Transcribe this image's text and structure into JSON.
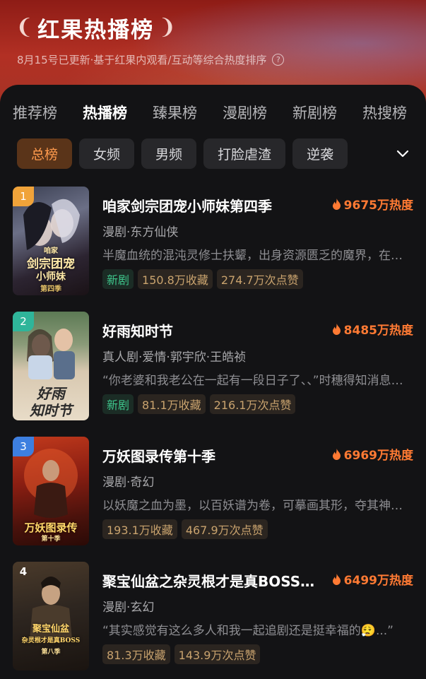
{
  "header": {
    "title": "红果热播榜",
    "subtitle": "8月15号已更新·基于红果内观看/互动等综合热度排序"
  },
  "tabs": [
    "推荐榜",
    "热播榜",
    "臻果榜",
    "漫剧榜",
    "新剧榜",
    "热搜榜"
  ],
  "active_tab": "热播榜",
  "filters": [
    "总榜",
    "女频",
    "男频",
    "打脸虐渣",
    "逆袭"
  ],
  "active_filter": "总榜",
  "colors": {
    "accent": "#ff7a33",
    "new_tag": "#3ec58b",
    "header_red": "#b23024"
  },
  "items": [
    {
      "rank": "1",
      "title": "咱家剑宗团宠小师妹第四季",
      "heat": "9675万热度",
      "meta": "漫剧·东方仙侠",
      "desc": "半魔血统的混沌灵修士扶颦，出身资源匮乏的魔界，在宗门中努力修炼成长",
      "tags": [
        "新剧",
        "150.8万收藏",
        "274.7万次点赞"
      ],
      "poster_text": [
        "咱家",
        "剑宗团宠",
        "小师妹",
        "第四季"
      ]
    },
    {
      "rank": "2",
      "title": "好雨知时节",
      "heat": "8485万热度",
      "meta": "真人剧·爱情·郭宇欣·王皓祯",
      "desc": "“你老婆和我老公在一起有一段日子了、、”时穗得知消息后陷入沉思",
      "tags": [
        "新剧",
        "81.1万收藏",
        "216.1万次点赞"
      ],
      "poster_text": [
        "好雨",
        "知时节"
      ]
    },
    {
      "rank": "3",
      "title": "万妖图录传第十季",
      "heat": "6969万热度",
      "meta": "漫剧·奇幻",
      "desc": "以妖魔之血为墨，以百妖谱为卷，可摹画其形，夺其神通万妖归一",
      "tags": [
        "193.1万收藏",
        "467.9万次点赞"
      ],
      "poster_text": [
        "万妖图录传",
        "第十季"
      ]
    },
    {
      "rank": "4",
      "title": "聚宝仙盆之杂灵根才是真BOSS第八季",
      "heat": "6499万热度",
      "meta": "漫剧·玄幻",
      "desc": "“其实感觉有这么多人和我一起追剧还是挺幸福的😮‍💨...”",
      "tags": [
        "81.3万收藏",
        "143.9万次点赞"
      ],
      "poster_text": [
        "聚宝仙盆",
        "杂灵根才是真BOSS",
        "第八季"
      ]
    }
  ]
}
